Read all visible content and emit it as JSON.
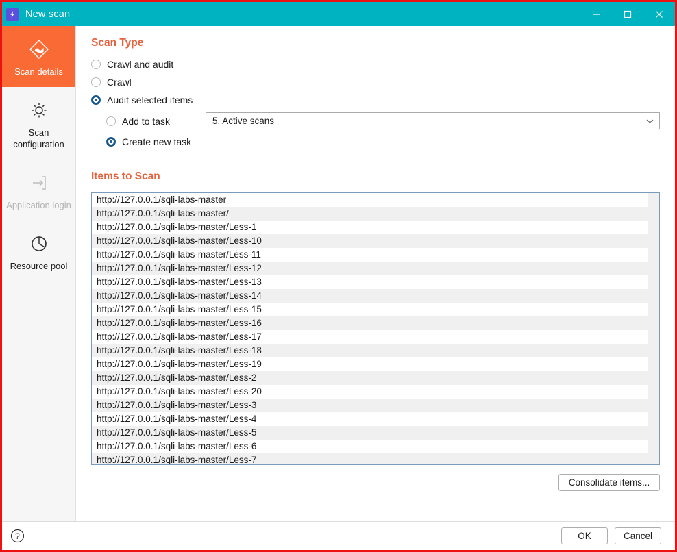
{
  "window": {
    "title": "New scan",
    "app_icon": "lightning-bolt-icon",
    "accent_teal": "#00b3c0",
    "accent_orange": "#f96a35",
    "heading_color": "#e8603c",
    "border_color": "#ee1111",
    "controls": {
      "minimize": "minimize-icon",
      "maximize": "maximize-icon",
      "close": "close-icon"
    }
  },
  "sidebar": {
    "items": [
      {
        "label": "Scan details",
        "icon": "scan-details-icon",
        "state": "active"
      },
      {
        "label": "Scan configuration",
        "icon": "gear-icon",
        "state": "normal"
      },
      {
        "label": "Application login",
        "icon": "login-arrow-icon",
        "state": "disabled"
      },
      {
        "label": "Resource pool",
        "icon": "pie-chart-icon",
        "state": "normal"
      }
    ]
  },
  "scan_type": {
    "title": "Scan Type",
    "options": [
      {
        "label": "Crawl and audit",
        "selected": false
      },
      {
        "label": "Crawl",
        "selected": false
      },
      {
        "label": "Audit selected items",
        "selected": true
      }
    ],
    "task_options": [
      {
        "label": "Add to task",
        "selected": false
      },
      {
        "label": "Create new task",
        "selected": true
      }
    ],
    "task_select": {
      "value": "5. Active scans",
      "chevron": "chevron-down-icon"
    }
  },
  "items_to_scan": {
    "title": "Items to Scan",
    "rows": [
      "http://127.0.0.1/sqli-labs-master",
      "http://127.0.0.1/sqli-labs-master/",
      "http://127.0.0.1/sqli-labs-master/Less-1",
      "http://127.0.0.1/sqli-labs-master/Less-10",
      "http://127.0.0.1/sqli-labs-master/Less-11",
      "http://127.0.0.1/sqli-labs-master/Less-12",
      "http://127.0.0.1/sqli-labs-master/Less-13",
      "http://127.0.0.1/sqli-labs-master/Less-14",
      "http://127.0.0.1/sqli-labs-master/Less-15",
      "http://127.0.0.1/sqli-labs-master/Less-16",
      "http://127.0.0.1/sqli-labs-master/Less-17",
      "http://127.0.0.1/sqli-labs-master/Less-18",
      "http://127.0.0.1/sqli-labs-master/Less-19",
      "http://127.0.0.1/sqli-labs-master/Less-2",
      "http://127.0.0.1/sqli-labs-master/Less-20",
      "http://127.0.0.1/sqli-labs-master/Less-3",
      "http://127.0.0.1/sqli-labs-master/Less-4",
      "http://127.0.0.1/sqli-labs-master/Less-5",
      "http://127.0.0.1/sqli-labs-master/Less-6",
      "http://127.0.0.1/sqli-labs-master/Less-7"
    ],
    "consolidate_label": "Consolidate items..."
  },
  "footer": {
    "help_icon": "help-circle-icon",
    "ok_label": "OK",
    "cancel_label": "Cancel"
  }
}
